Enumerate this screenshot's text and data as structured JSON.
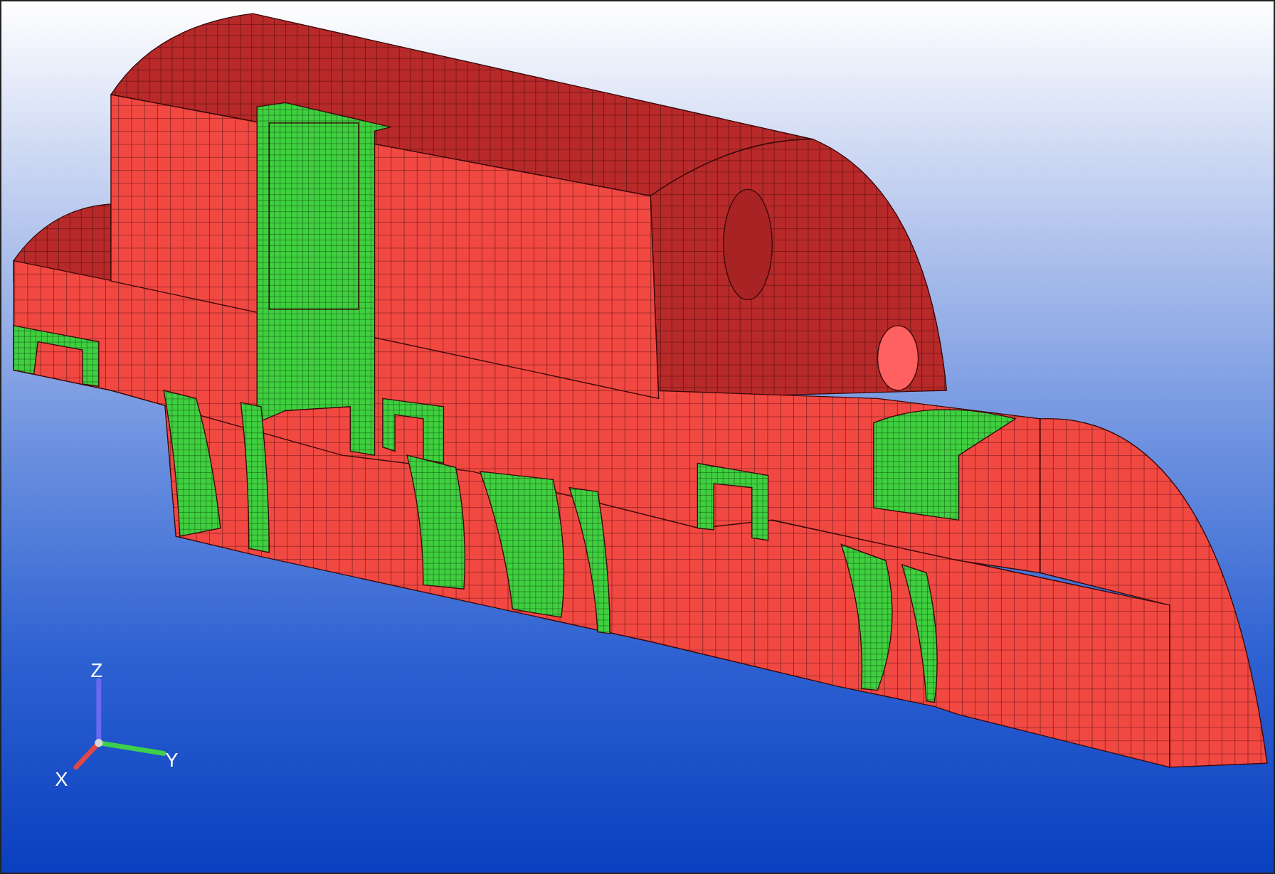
{
  "viewport": {
    "axes": [
      {
        "label": "Z"
      },
      {
        "label": "Y"
      },
      {
        "label": "X"
      }
    ]
  }
}
